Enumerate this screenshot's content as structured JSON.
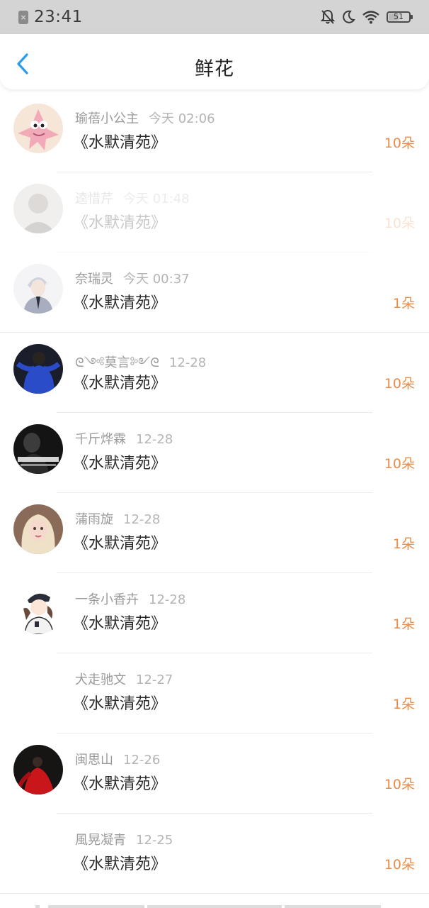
{
  "status_bar": {
    "time": "23:41",
    "battery": "51",
    "battery_level": 0.51,
    "icons": [
      "notification-blocked-icon",
      "bell-off-icon",
      "moon-icon",
      "wifi-icon",
      "battery-icon"
    ]
  },
  "header": {
    "title": "鲜花",
    "back_icon": "chevron-left-icon"
  },
  "colors": {
    "accent": "#ea8d4a",
    "back_arrow": "#2a9bf0",
    "status_bar_bg": "#d4d4d4"
  },
  "items": [
    {
      "name": "瑜蓓小公主",
      "time": "今天 02:06",
      "book": "《水默清苑》",
      "count": "10朵",
      "avatar": "patrick-star"
    },
    {
      "name": "逵惜芹",
      "time": "今天 01:48",
      "book": "《水默清苑》",
      "count": "10朵",
      "avatar": "girl-photo-faded"
    },
    {
      "name": "奈瑞灵",
      "time": "今天 00:37",
      "book": "《水默清苑》",
      "count": "1朵",
      "avatar": "anime-boy"
    },
    {
      "name": "ᘓ༺莫言༻ᘓ",
      "time": "12-28",
      "book": "《水默清苑》",
      "count": "10朵",
      "avatar": "blue-figure"
    },
    {
      "name": "千斤烨霖",
      "time": "12-28",
      "book": "《水默清苑》",
      "count": "10朵",
      "avatar": "dark-text"
    },
    {
      "name": "蒲雨旋",
      "time": "12-28",
      "book": "《水默清苑》",
      "count": "1朵",
      "avatar": "blonde-girl"
    },
    {
      "name": "一条小香卉",
      "time": "12-28",
      "book": "《水默清苑》",
      "count": "1朵",
      "avatar": "cartoon-character"
    },
    {
      "name": "犬走驰文",
      "time": "12-27",
      "book": "《水默清苑》",
      "count": "1朵",
      "avatar": "none"
    },
    {
      "name": "闽思山",
      "time": "12-26",
      "book": "《水默清苑》",
      "count": "10朵",
      "avatar": "red-dress"
    },
    {
      "name": "風晃凝青",
      "time": "12-25",
      "book": "《水默清苑》",
      "count": "10朵",
      "avatar": "none"
    }
  ]
}
